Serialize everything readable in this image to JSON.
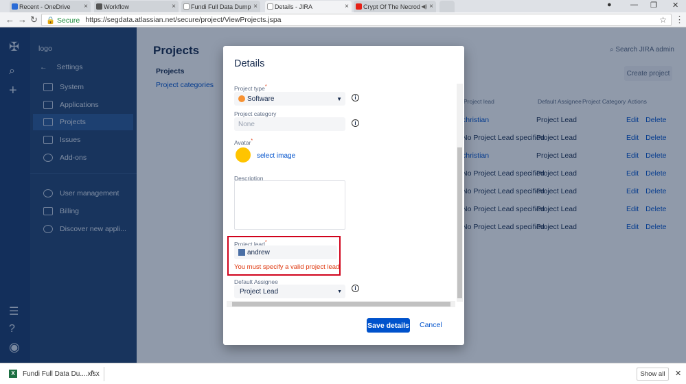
{
  "browser": {
    "tabs": [
      {
        "title": "Recent - OneDrive",
        "close": "×",
        "icon_color": "#2a6bd6"
      },
      {
        "title": "Workflow",
        "close": "×",
        "icon_color": "#555555"
      },
      {
        "title": "Fundi Full Data Dump Re",
        "close": "×",
        "icon_color": "#777777"
      },
      {
        "title": "Details - JIRA",
        "close": "×",
        "icon_color": "#777777"
      },
      {
        "title": "Crypt Of The Necrod",
        "close": "×",
        "icon_color": "#e62117"
      }
    ],
    "secure_label": "Secure",
    "url": "https://segdata.atlassian.net/secure/project/ViewProjects.jspa"
  },
  "sidebar": {
    "logo": "logo",
    "back_label": "Settings",
    "items": [
      "System",
      "Applications",
      "Projects",
      "Issues",
      "Add-ons"
    ],
    "items2": [
      "User management",
      "Billing",
      "Discover new appli..."
    ]
  },
  "page": {
    "title": "Projects",
    "side_projects": "Projects",
    "side_categories": "Project categories",
    "search": "Search JIRA admin",
    "create": "Create project",
    "columns": [
      "Project lead",
      "Default Assignee",
      "Project Category",
      "Actions"
    ],
    "rows": [
      {
        "lead": "christian",
        "assignee": "Project Lead"
      },
      {
        "lead": "No Project Lead specified",
        "assignee": "Project Lead"
      },
      {
        "lead": "christian",
        "assignee": "Project Lead"
      },
      {
        "lead": "No Project Lead specified",
        "assignee": "Project Lead"
      },
      {
        "lead": "No Project Lead specified",
        "assignee": "Project Lead"
      },
      {
        "lead": "No Project Lead specified",
        "assignee": "Project Lead"
      },
      {
        "lead": "No Project Lead specified",
        "assignee": "Project Lead"
      }
    ],
    "edit": "Edit",
    "delete": "Delete"
  },
  "modal": {
    "title": "Details",
    "project_type_label": "Project type",
    "project_type_value": "Software",
    "category_label": "Project category",
    "category_value": "None",
    "avatar_label": "Avatar",
    "select_image": "select image",
    "description_label": "Description",
    "lead_label": "Project lead",
    "lead_value": "andrew",
    "lead_error": "You must specify a valid project lead.",
    "assignee_label": "Default Assignee",
    "assignee_value": "Project Lead",
    "save": "Save details",
    "cancel": "Cancel",
    "required": "*"
  },
  "download": {
    "file": "Fundi Full Data Du....xlsx",
    "show_all": "Show all"
  },
  "colors": {
    "primary": "#0052cc",
    "error": "#de350b",
    "sidebar": "#254673"
  }
}
